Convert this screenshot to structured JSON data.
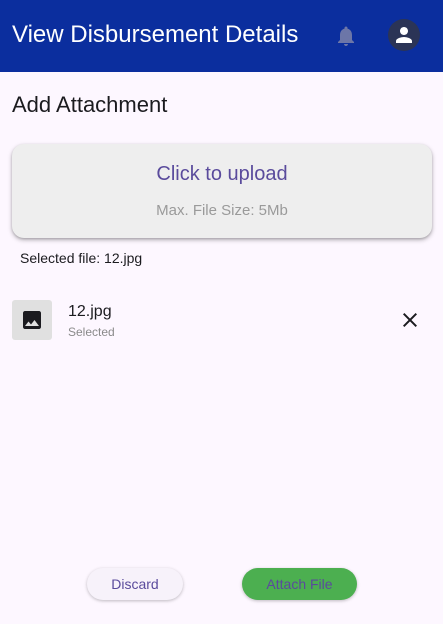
{
  "appbar": {
    "title": "View Disbursement Details",
    "icons": {
      "notifications": "bell-icon",
      "account": "account-icon"
    },
    "background_color": "#0b2e9e"
  },
  "page": {
    "title": "Add Attachment"
  },
  "upload": {
    "label": "Click to upload",
    "hint": "Max. File Size: 5Mb"
  },
  "selected_file_text": "Selected file: 12.jpg",
  "files": [
    {
      "name": "12.jpg",
      "status": "Selected",
      "icon": "image-icon",
      "remove_icon": "close-icon"
    }
  ],
  "actions": {
    "discard_label": "Discard",
    "attach_label": "Attach File",
    "attach_color": "#4caf50"
  }
}
